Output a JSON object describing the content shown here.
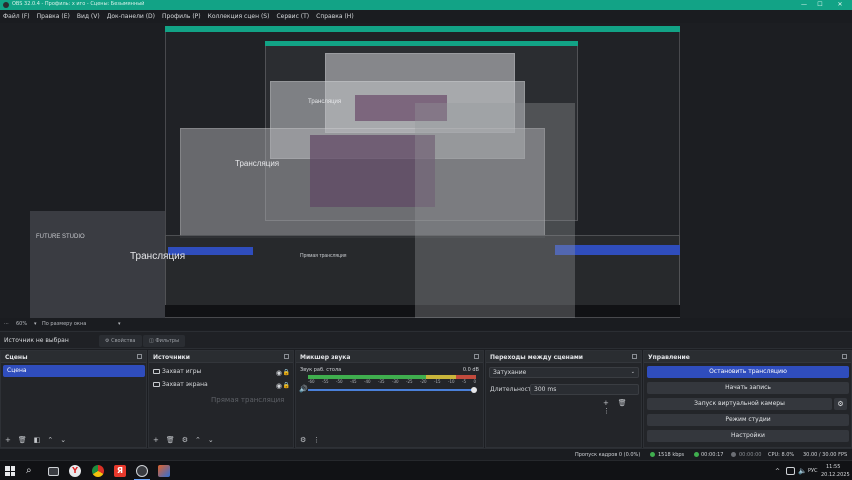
{
  "titlebar": {
    "title": "OBS 32.0.4 - Профиль: x иго - Сцены: Безымянный",
    "minimize": "—",
    "maximize": "☐",
    "close": "✕"
  },
  "menu": [
    "Файл (F)",
    "Правка (E)",
    "Вид (V)",
    "Док-панели (D)",
    "Профиль (P)",
    "Коллекция сцен (S)",
    "Сервис (T)",
    "Справка (H)"
  ],
  "preview": {
    "watermark_small": "FUTURE STUDIO",
    "caption": "Трансляция",
    "overlay_caption": "Прямая трансляция"
  },
  "strip": {
    "zoom": "60%",
    "fit_mode": "По размеру окна"
  },
  "source_bar": {
    "no_source": "Источник не выбран",
    "properties": "Свойства",
    "filters": "Фильтры"
  },
  "scenes": {
    "title": "Сцены",
    "items": [
      "Сцена"
    ]
  },
  "sources": {
    "title": "Источники",
    "items": [
      "Захват игры",
      "Захват экрана"
    ],
    "overlay": "Прямая трансляция"
  },
  "mixer": {
    "title": "Микшер звука",
    "channel": "Звук раб. стола",
    "db": "0.0 dB",
    "ticks": [
      "-60",
      "-55",
      "-50",
      "-45",
      "-40",
      "-35",
      "-30",
      "-25",
      "-20",
      "-15",
      "-10",
      "-5",
      "0"
    ],
    "level": 1.0
  },
  "transitions": {
    "title": "Переходы между сценами",
    "type": "Затухание",
    "duration_label": "Длительность",
    "duration_value": "300 ms"
  },
  "controls": {
    "title": "Управление",
    "stop_stream": "Остановить трансляцию",
    "start_record": "Начать запись",
    "virtual_cam": "Запуск виртуальной камеры",
    "studio_mode": "Режим студии",
    "settings": "Настройки"
  },
  "status": {
    "dropped": "Пропуск кадров 0 (0.0%)",
    "bitrate": "1518 kbps",
    "stream_time": "00:00:17",
    "record_time": "00:00:00",
    "cpu": "CPU: 8.0%",
    "fps": "30.00 / 30.00 FPS"
  },
  "taskbar": {
    "lang": "РУС",
    "time": "11:55",
    "date": "20.12.2025"
  },
  "colors": {
    "accent": "#2f4dbd",
    "titlebar": "#12a386",
    "meter_green": "#3fae4e",
    "meter_yellow": "#c9b53b",
    "meter_red": "#c24b3d",
    "live": "#3fae4e"
  }
}
